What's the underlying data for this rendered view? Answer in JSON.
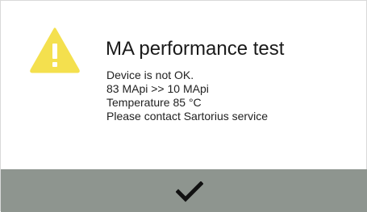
{
  "dialog": {
    "icon": "warning-triangle-icon",
    "title": "MA performance test",
    "message_lines": [
      "Device is not OK.",
      "83 MApi >> 10 MApi",
      "Temperature 85 °C",
      "Please contact Sartorius service"
    ],
    "confirm_icon": "checkmark-icon"
  },
  "colors": {
    "warning": "#F4E04E",
    "button_bar": "#8E958F",
    "check": "#111111",
    "background": "#FFFFFF"
  }
}
